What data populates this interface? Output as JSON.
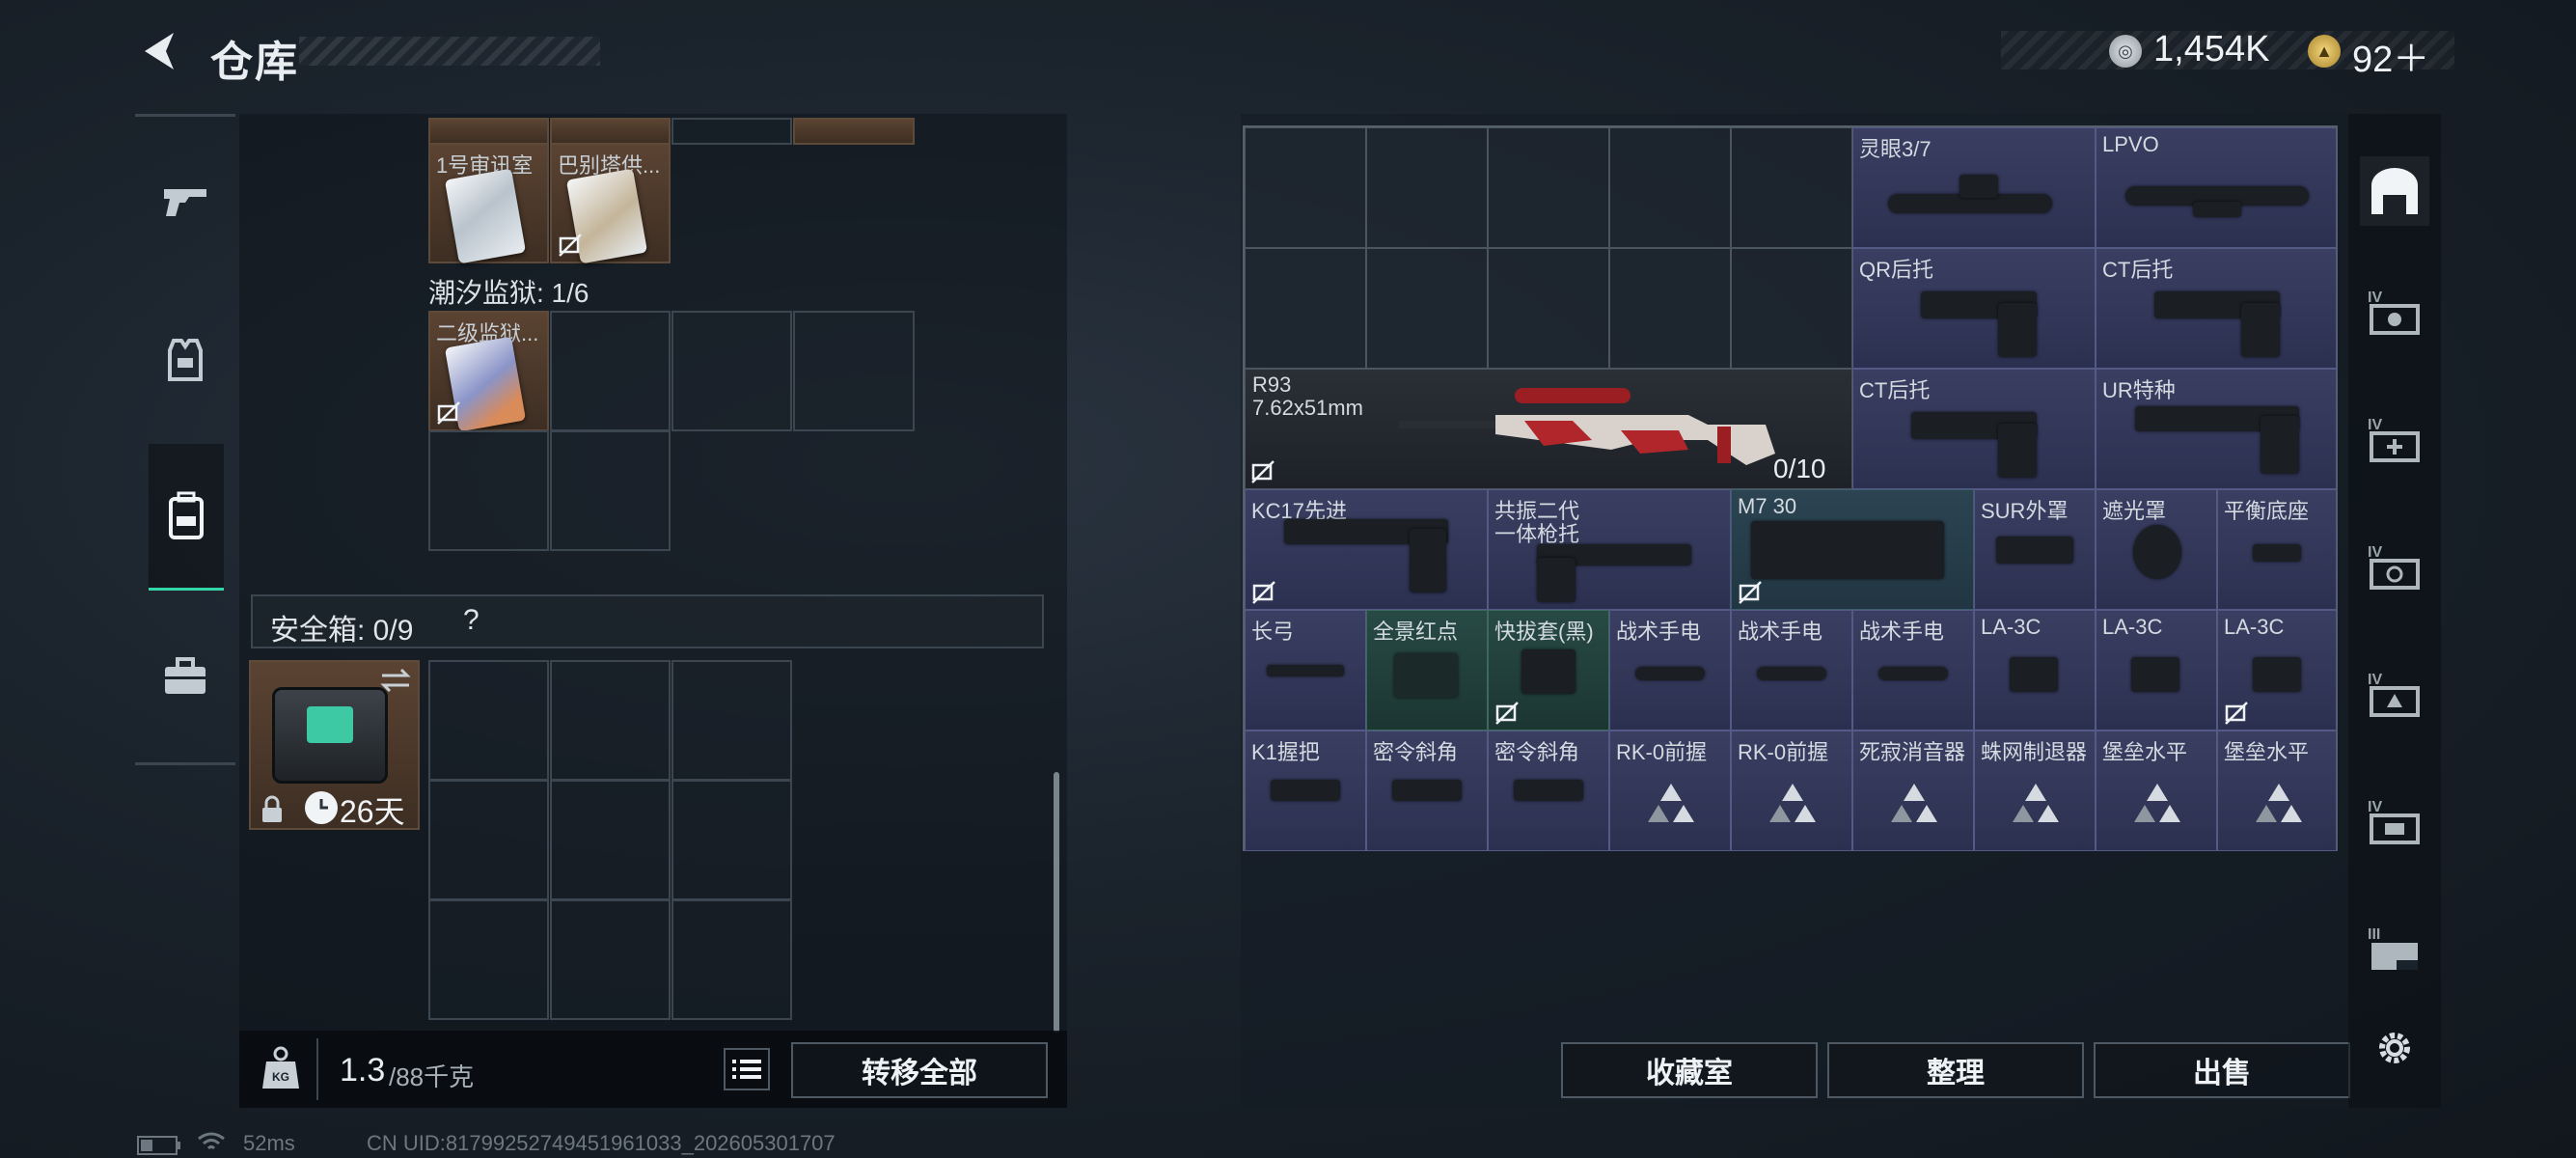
{
  "header": {
    "title": "仓库",
    "currency": {
      "silver": "1,454K",
      "gold": "92＋"
    }
  },
  "left_panel": {
    "top_items": [
      "1号审讯室",
      "巴别塔供..."
    ],
    "section_prison": "潮汐监狱: 1/6",
    "prison_item": "二级监狱...",
    "safebox_label": "安全箱: 0/9",
    "safebox_help": "?",
    "safebox_days": "26天",
    "weight_current": "1.3",
    "weight_max": "/88千克",
    "transfer_all": "转移全部"
  },
  "right_panel": {
    "row1": [
      "灵眼3/7",
      "LPVO"
    ],
    "row2": [
      "QR后托",
      "CT后托"
    ],
    "gun": {
      "name": "R93",
      "caliber": "7.62x51mm",
      "ammo": "0/10"
    },
    "row3": [
      "CT后托",
      "UR特种"
    ],
    "row4": [
      "KC17先进",
      "共振二代",
      "一体枪托",
      "M7 30",
      "SUR外罩",
      "遮光罩",
      "平衡底座"
    ],
    "row5": [
      "长弓",
      "全景红点",
      "快拔套(黑)",
      "战术手电",
      "战术手电",
      "战术手电",
      "LA-3C",
      "LA-3C",
      "LA-3C"
    ],
    "row6": [
      "K1握把",
      "密令斜角",
      "密令斜角",
      "RK-0前握",
      "RK-0前握",
      "死寂消音器",
      "蛛网制退器",
      "堡垒水平",
      "堡垒水平"
    ],
    "buttons": {
      "collection": "收藏室",
      "sort": "整理",
      "sell": "出售"
    }
  },
  "status": {
    "ping": "52ms",
    "uid": "CN UID:81799252749451961033_202605301707"
  },
  "colors": {
    "accent": "#34d6a8",
    "purple": "#3a3f62",
    "green": "#284a44",
    "brown": "#5b4332"
  }
}
